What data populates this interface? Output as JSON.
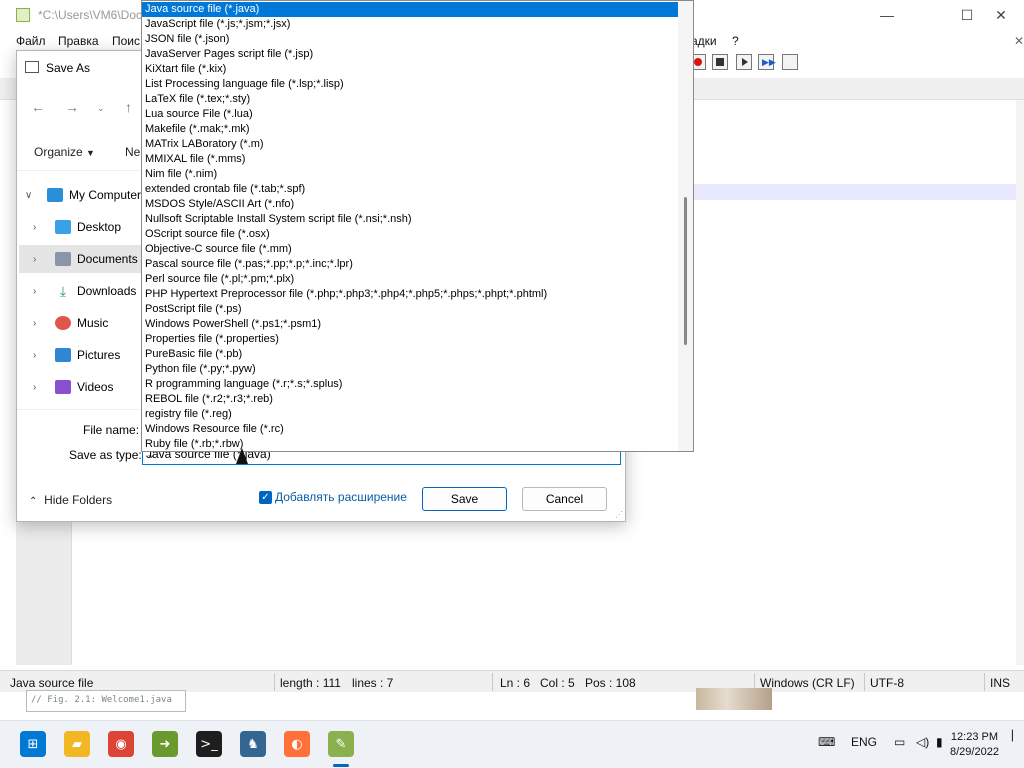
{
  "notepad": {
    "window_title": "*C:\\Users\\VM6\\Doc",
    "menu": [
      "Файл",
      "Правка",
      "Поис",
      "адки",
      "?"
    ],
    "preview_text": "// Fig. 2.1: Welcome1.java",
    "status": {
      "filetype": "Java source file",
      "length": "length : 111",
      "lines": "lines : 7",
      "ln": "Ln : 6",
      "col": "Col : 5",
      "pos": "Pos : 108",
      "eol": "Windows (CR LF)",
      "encoding": "UTF-8",
      "mode": "INS"
    }
  },
  "dialog": {
    "title": "Save As",
    "organize": "Organize",
    "new_folder": "Ne",
    "tree": [
      {
        "label": "My Computer",
        "expanded": true,
        "color": "#2a8fd6"
      },
      {
        "label": "Desktop",
        "color": "#3aa1e6"
      },
      {
        "label": "Documents",
        "color": "#8a96a8"
      },
      {
        "label": "Downloads",
        "color": "#2e9d6a"
      },
      {
        "label": "Music",
        "color": "#e0564a"
      },
      {
        "label": "Pictures",
        "color": "#2f86d2"
      },
      {
        "label": "Videos",
        "color": "#8a4fd0"
      }
    ],
    "file_name_label": "File name:",
    "save_as_type_label": "Save as type:",
    "save_as_type_value": "Java source file (*.java)",
    "add_extension_label": "Добавлять расширение",
    "add_extension_checked": true,
    "hide_folders": "Hide Folders",
    "save": "Save",
    "cancel": "Cancel"
  },
  "dropdown": {
    "selected_index": 0,
    "items": [
      "Java source file (*.java)",
      "JavaScript file (*.js;*.jsm;*.jsx)",
      "JSON file (*.json)",
      "JavaServer Pages script file (*.jsp)",
      "KiXtart file (*.kix)",
      "List Processing language file (*.lsp;*.lisp)",
      "LaTeX file (*.tex;*.sty)",
      "Lua source File (*.lua)",
      "Makefile (*.mak;*.mk)",
      "MATrix LABoratory (*.m)",
      "MMIXAL file (*.mms)",
      "Nim file (*.nim)",
      "extended crontab file (*.tab;*.spf)",
      "MSDOS Style/ASCII Art (*.nfo)",
      "Nullsoft Scriptable Install System script file (*.nsi;*.nsh)",
      "OScript source file (*.osx)",
      "Objective-C source file (*.mm)",
      "Pascal source file (*.pas;*.pp;*.p;*.inc;*.lpr)",
      "Perl source file (*.pl;*.pm;*.plx)",
      "PHP Hypertext Preprocessor file (*.php;*.php3;*.php4;*.php5;*.phps;*.phpt;*.phtml)",
      "PostScript file (*.ps)",
      "Windows PowerShell (*.ps1;*.psm1)",
      "Properties file (*.properties)",
      "PureBasic file (*.pb)",
      "Python file (*.py;*.pyw)",
      "R programming language (*.r;*.s;*.splus)",
      "REBOL file (*.r2;*.r3;*.reb)",
      "registry file (*.reg)",
      "Windows Resource file (*.rc)",
      "Ruby file (*.rb;*.rbw)"
    ]
  },
  "taskbar": {
    "apps": [
      {
        "name": "start",
        "glyph": "⊞",
        "color": "#0078d4"
      },
      {
        "name": "file-explorer",
        "glyph": "▰",
        "color": "#f2b824"
      },
      {
        "name": "chrome",
        "glyph": "◉",
        "color": "#db4437"
      },
      {
        "name": "app-green-arrow",
        "glyph": "➜",
        "color": "#6a9a2e"
      },
      {
        "name": "terminal",
        "glyph": ">_",
        "color": "#1e1e1e"
      },
      {
        "name": "postgres",
        "glyph": "♞",
        "color": "#336791"
      },
      {
        "name": "firefox",
        "glyph": "◐",
        "color": "#ff7139"
      },
      {
        "name": "notepad-plus-plus",
        "glyph": "✎",
        "color": "#8bb04e"
      }
    ],
    "language": "ENG",
    "time": "12:23 PM",
    "date": "8/29/2022"
  }
}
